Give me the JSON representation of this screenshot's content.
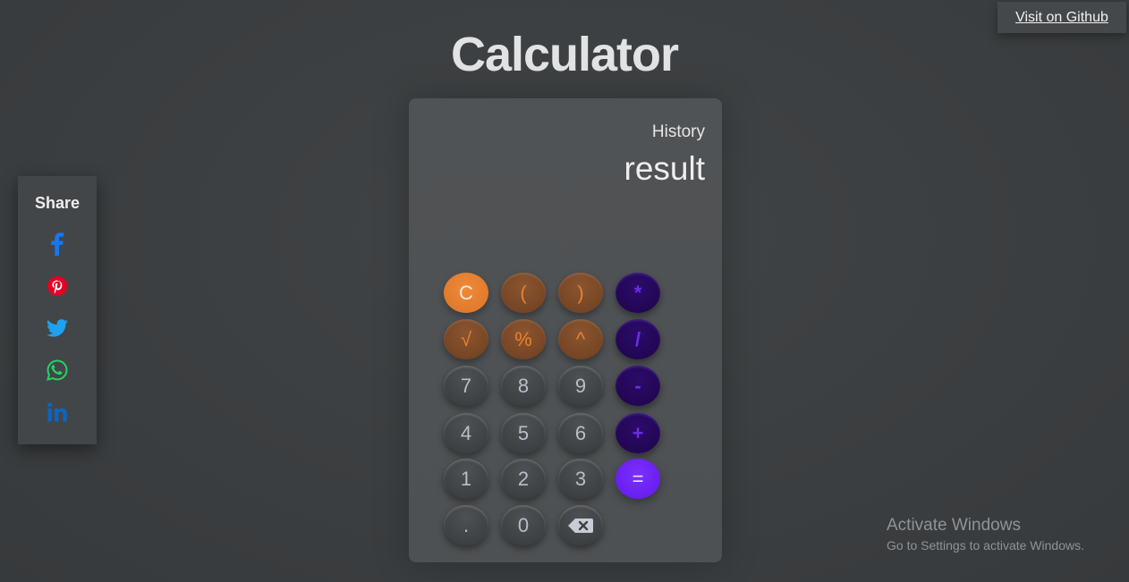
{
  "page": {
    "title": "Calculator",
    "github_link": "Visit on Github"
  },
  "share": {
    "title": "Share",
    "icons": [
      {
        "name": "facebook-icon",
        "color": "#1877f2"
      },
      {
        "name": "pinterest-icon",
        "color": "#e60023"
      },
      {
        "name": "twitter-icon",
        "color": "#1da1f2"
      },
      {
        "name": "whatsapp-icon",
        "color": "#25d366"
      },
      {
        "name": "linkedin-icon",
        "color": "#0a66c2"
      }
    ]
  },
  "calculator": {
    "history_label": "History",
    "result_text": "result",
    "keys": {
      "clear": "C",
      "open_paren": "(",
      "close_paren": ")",
      "multiply": "*",
      "sqrt": "√",
      "percent": "%",
      "power": "^",
      "divide": "/",
      "seven": "7",
      "eight": "8",
      "nine": "9",
      "minus": "-",
      "four": "4",
      "five": "5",
      "six": "6",
      "plus": "+",
      "one": "1",
      "two": "2",
      "three": "3",
      "equals": "=",
      "dot": ".",
      "zero": "0",
      "backspace_icon": "backspace-icon"
    },
    "colors": {
      "clear": "#e07b2e",
      "function": "#7a4826",
      "function_text": "#e8822e",
      "number": "#3e4143",
      "operator": "#230755",
      "operator_text": "#6a2de8",
      "equals": "#6a1ff0"
    }
  },
  "watermark": {
    "title": "Activate Windows",
    "subtitle": "Go to Settings to activate Windows."
  }
}
